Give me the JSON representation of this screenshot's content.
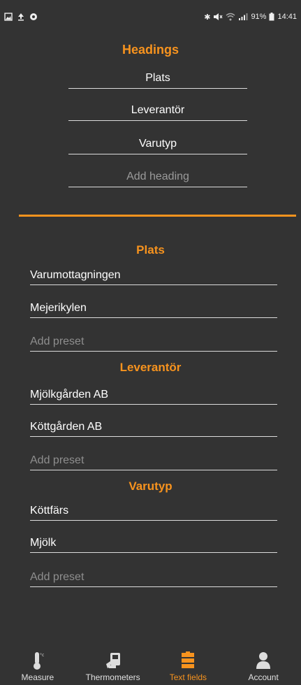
{
  "status_bar": {
    "left_icons": [
      "image-icon",
      "upload-icon",
      "circle-icon"
    ],
    "bluetooth": "✱",
    "signal": "91%",
    "time": "14:41"
  },
  "headings": {
    "title": "Headings",
    "items": [
      "Plats",
      "Leverantör",
      "Varutyp"
    ],
    "add_placeholder": "Add heading"
  },
  "groups": [
    {
      "title": "Plats",
      "presets": [
        "Varumottagningen",
        "Mejerikylen"
      ],
      "add_placeholder": "Add preset"
    },
    {
      "title": "Leverantör",
      "presets": [
        "Mjölkgården AB",
        "Köttgården AB"
      ],
      "add_placeholder": "Add preset"
    },
    {
      "title": "Varutyp",
      "presets": [
        "Köttfärs",
        "Mjölk"
      ],
      "add_placeholder": "Add preset"
    }
  ],
  "bottom_nav": [
    {
      "label": "Measure",
      "icon": "thermometer-icon",
      "active": false
    },
    {
      "label": "Thermometers",
      "icon": "device-icon",
      "active": false
    },
    {
      "label": "Text fields",
      "icon": "text-fields-icon",
      "active": true
    },
    {
      "label": "Account",
      "icon": "person-icon",
      "active": false
    }
  ],
  "colors": {
    "accent": "#f7931e",
    "background": "#333333"
  }
}
